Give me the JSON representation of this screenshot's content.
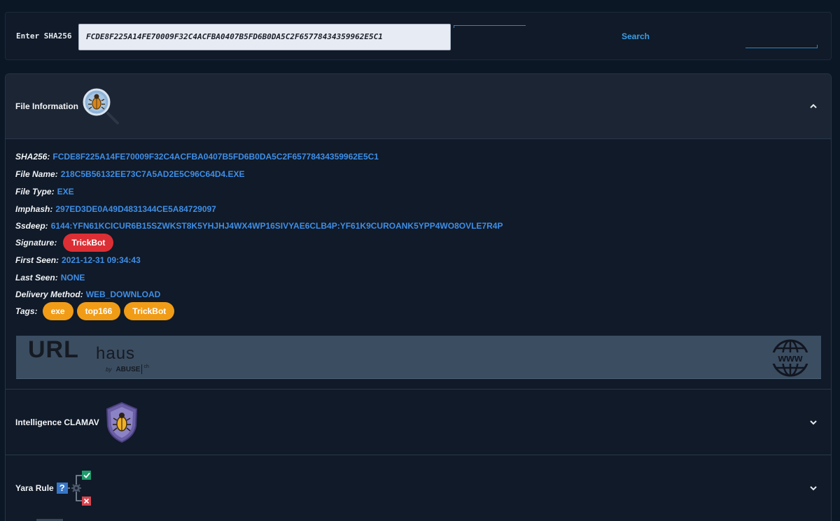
{
  "search": {
    "label": "Enter SHA256",
    "value": "FCDE8F225A14FE70009F32C4ACFBA0407B5FD6B0DA5C2F65778434359962E5C1",
    "button_label": "Search"
  },
  "file_info": {
    "title": "File Information",
    "sha256_label": "SHA256:",
    "sha256": "FCDE8F225A14FE70009F32C4ACFBA0407B5FD6B0DA5C2F65778434359962E5C1",
    "file_name_label": "File Name:",
    "file_name": "218C5B56132EE73C7A5AD2E5C96C64D4.EXE",
    "file_type_label": "File Type:",
    "file_type": "EXE",
    "imphash_label": "Imphash:",
    "imphash": "297ED3DE0A49D4831344CE5A84729097",
    "ssdeep_label": "Ssdeep:",
    "ssdeep": "6144:YFN61KCICUR6B15SZWKST8K5YHJHJ4WX4WP16SIVYAE6CLB4P:YF61K9CUROANK5YPP4WO8OVLE7R4P",
    "signature_label": "Signature:",
    "signature": "TrickBot",
    "first_seen_label": "First Seen:",
    "first_seen": "2021-12-31 09:34:43",
    "last_seen_label": "Last Seen:",
    "last_seen": "NONE",
    "delivery_label": "Delivery Method:",
    "delivery": "WEB_DOWNLOAD",
    "tags_label": "Tags:",
    "tags": [
      "exe",
      "top166",
      "TrickBot"
    ]
  },
  "banner": {
    "url": "URL",
    "haus": "haus",
    "by": "by",
    "abuse": "ABUSE",
    "ch": "ch",
    "www": "www"
  },
  "sections": {
    "clamav_title": "Intelligence CLAMAV",
    "yara_title": "Yara Rule",
    "yara_q": "?"
  },
  "colors": {
    "accent": "#3f8ee6",
    "signature": "#dc2f35",
    "tag": "#f19c17"
  },
  "icons": {
    "file_info": "bug-magnifier-icon",
    "clamav": "shield-bug-icon",
    "yara": "gear-flow-check-cross-icon",
    "globe": "globe-www-icon"
  }
}
